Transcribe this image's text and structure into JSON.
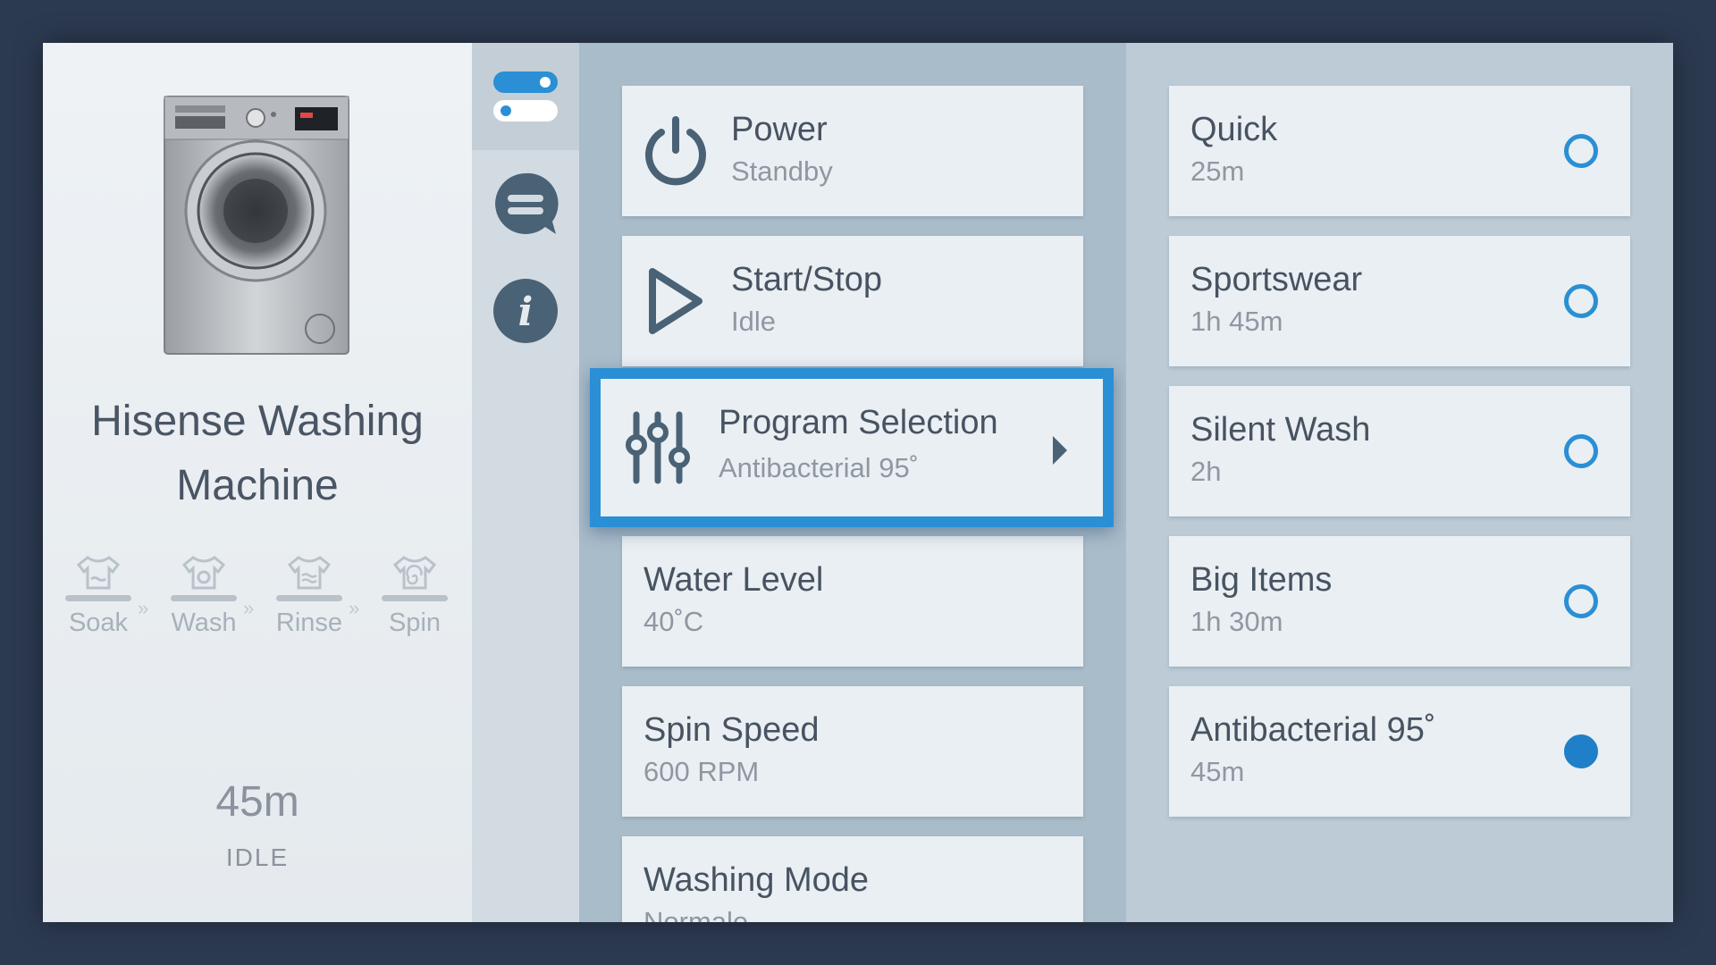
{
  "device": {
    "name": "Hisense Washing Machine",
    "time_remaining": "45m",
    "state": "IDLE",
    "stages": [
      {
        "label": "Soak",
        "icon": "shirt-soak-icon"
      },
      {
        "label": "Wash",
        "icon": "shirt-wash-icon"
      },
      {
        "label": "Rinse",
        "icon": "shirt-rinse-icon"
      },
      {
        "label": "Spin",
        "icon": "shirt-spin-icon"
      }
    ],
    "stage_separator": "»"
  },
  "nav": {
    "items": [
      {
        "icon": "toggles-icon",
        "active": true
      },
      {
        "icon": "chat-icon",
        "active": false
      },
      {
        "icon": "info-icon",
        "active": false
      }
    ],
    "info_glyph": "i"
  },
  "controls": [
    {
      "title": "Power",
      "value": "Standby",
      "icon": "power-icon"
    },
    {
      "title": "Start/Stop",
      "value": "Idle",
      "icon": "play-icon"
    },
    {
      "title": "Program Selection",
      "value": "Antibacterial 95˚",
      "icon": "sliders-icon",
      "selected": true
    },
    {
      "title": "Water Level",
      "value": "40˚C"
    },
    {
      "title": "Spin Speed",
      "value": "600 RPM"
    },
    {
      "title": "Washing Mode",
      "value": "Normale"
    }
  ],
  "programs": [
    {
      "title": "Quick",
      "duration": "25m",
      "selected": false
    },
    {
      "title": "Sportswear",
      "duration": "1h 45m",
      "selected": false
    },
    {
      "title": "Silent Wash",
      "duration": "2h",
      "selected": false
    },
    {
      "title": "Big Items",
      "duration": "1h 30m",
      "selected": false
    },
    {
      "title": "Antibacterial 95˚",
      "duration": "45m",
      "selected": true
    }
  ],
  "colors": {
    "accent": "#2a8fd5",
    "icon_dark": "#4a6275",
    "background": "#2c3a51"
  }
}
